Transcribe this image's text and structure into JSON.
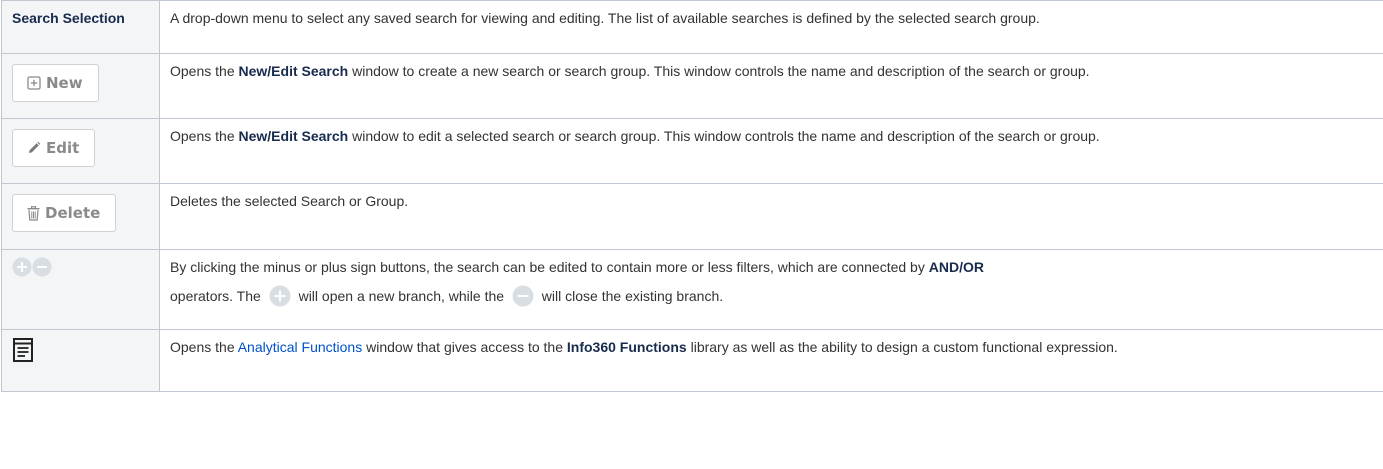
{
  "rows": [
    {
      "label": "Search Selection",
      "description": "A drop-down menu to select any saved search for viewing and editing. The list of available searches is defined by the selected search group."
    },
    {
      "button": {
        "icon": "plus-box-icon",
        "label": "New"
      },
      "desc_a": "Opens the ",
      "desc_bold": "New/Edit Search",
      "desc_b": " window to create a new search or search group. This window controls the name and description of the search or group."
    },
    {
      "button": {
        "icon": "pencil-icon",
        "label": "Edit"
      },
      "desc_a": "Opens the ",
      "desc_bold": "New/Edit Search",
      "desc_b": " window to edit a selected search or search group. This window controls the name and description of the search or group."
    },
    {
      "button": {
        "icon": "trash-icon",
        "label": "Delete"
      },
      "description": "Deletes the selected Search or Group."
    },
    {
      "icons": [
        "plus-circle-icon",
        "minus-circle-icon"
      ],
      "desc_a": "By clicking the minus or plus sign buttons, the search can be edited to contain more or less filters, which are connected by ",
      "desc_bold": "AND/OR",
      "desc_b": " operators. The ",
      "desc_c": " will open a new branch, while the ",
      "desc_d": " will close the existing branch."
    },
    {
      "icon": "functions-document-icon",
      "desc_a": "Opens the ",
      "desc_link": "Analytical Functions",
      "desc_b": " window that gives access to the ",
      "desc_bold": "Info360 Functions",
      "desc_c": " library as well as the ability to design a custom functional expression."
    }
  ],
  "colors": {
    "header_bg": "#f4f5f7",
    "border": "#c1c7d0",
    "link": "#0052cc",
    "icon_circle": "#d9dee3"
  }
}
